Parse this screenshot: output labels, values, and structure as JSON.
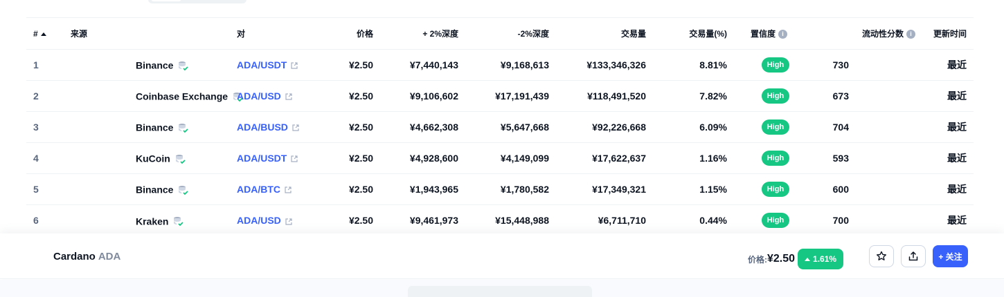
{
  "table": {
    "headers": {
      "num": "#",
      "source": "来源",
      "pair": "对",
      "price": "价格",
      "depth_plus": "+ 2%深度",
      "depth_minus": "-2%深度",
      "volume": "交易量",
      "volume_pct": "交易量(%)",
      "confidence": "置信度",
      "liquidity": "流动性分数",
      "updated": "更新时间"
    },
    "rows": [
      {
        "num": "1",
        "source": "Binance",
        "pair": "ADA/USDT",
        "price": "¥2.50",
        "depth_plus": "¥7,440,143",
        "depth_minus": "¥9,168,613",
        "volume": "¥133,346,326",
        "volume_pct": "8.81%",
        "confidence": "High",
        "liquidity": "730",
        "updated": "最近"
      },
      {
        "num": "2",
        "source": "Coinbase Exchange",
        "pair": "ADA/USD",
        "price": "¥2.50",
        "depth_plus": "¥9,106,602",
        "depth_minus": "¥17,191,439",
        "volume": "¥118,491,520",
        "volume_pct": "7.82%",
        "confidence": "High",
        "liquidity": "673",
        "updated": "最近"
      },
      {
        "num": "3",
        "source": "Binance",
        "pair": "ADA/BUSD",
        "price": "¥2.50",
        "depth_plus": "¥4,662,308",
        "depth_minus": "¥5,647,668",
        "volume": "¥92,226,668",
        "volume_pct": "6.09%",
        "confidence": "High",
        "liquidity": "704",
        "updated": "最近"
      },
      {
        "num": "4",
        "source": "KuCoin",
        "pair": "ADA/USDT",
        "price": "¥2.50",
        "depth_plus": "¥4,928,600",
        "depth_minus": "¥4,149,099",
        "volume": "¥17,622,637",
        "volume_pct": "1.16%",
        "confidence": "High",
        "liquidity": "593",
        "updated": "最近"
      },
      {
        "num": "5",
        "source": "Binance",
        "pair": "ADA/BTC",
        "price": "¥2.50",
        "depth_plus": "¥1,943,965",
        "depth_minus": "¥1,780,582",
        "volume": "¥17,349,321",
        "volume_pct": "1.15%",
        "confidence": "High",
        "liquidity": "600",
        "updated": "最近"
      },
      {
        "num": "6",
        "source": "Kraken",
        "pair": "ADA/USD",
        "price": "¥2.50",
        "depth_plus": "¥9,461,973",
        "depth_minus": "¥15,448,988",
        "volume": "¥6,711,710",
        "volume_pct": "0.44%",
        "confidence": "High",
        "liquidity": "700",
        "updated": "最近"
      }
    ]
  },
  "bottom_bar": {
    "coin_name": "Cardano",
    "coin_symbol": "ADA",
    "price_label": "价格:",
    "price": "¥2.50",
    "change": "1.61%",
    "follow_label": "+ 关注"
  },
  "colors": {
    "accent": "#3861fb",
    "positive": "#16c784",
    "muted": "#58667e"
  }
}
